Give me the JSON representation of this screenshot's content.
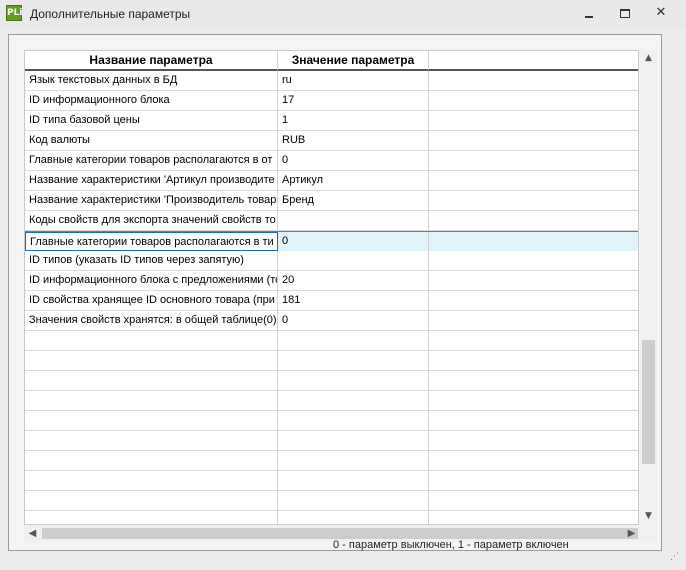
{
  "window": {
    "icon_text": "PLi",
    "title": "Дополнительные параметры",
    "close_glyph": "✕"
  },
  "grid": {
    "columns": [
      "Название параметра",
      "Значение параметра",
      ""
    ],
    "rows": [
      {
        "name": "Язык текстовых данных в БД",
        "value": "ru"
      },
      {
        "name": "ID информационного блока",
        "value": "17"
      },
      {
        "name": "ID типа базовой цены",
        "value": "1"
      },
      {
        "name": "Код валюты",
        "value": "RUB"
      },
      {
        "name": "Главные категории товаров располагаются в от",
        "value": "0"
      },
      {
        "name": "Название характеристики 'Артикул производите",
        "value": "Артикул"
      },
      {
        "name": "Название характеристики 'Производитель товар",
        "value": "Бренд"
      },
      {
        "name": "Коды свойств для экспорта значений свойств то",
        "value": ""
      },
      {
        "name": "Главные категории товаров располагаются в ти",
        "value": "0"
      },
      {
        "name": "ID типов (указать ID типов через запятую)",
        "value": ""
      },
      {
        "name": "ID информационного блока с предложениями (то",
        "value": "20"
      },
      {
        "name": "ID свойства хранящее ID основного товара (при",
        "value": "181"
      },
      {
        "name": "Значения свойств хранятся: в общей таблице(0)",
        "value": "0"
      }
    ],
    "selected_row": 8,
    "empty_rows": 10
  },
  "scrollbars": {
    "up": "▲",
    "down": "▼",
    "left": "◀",
    "right": "▶"
  },
  "status_text": "0 - параметр выключен, 1 - параметр включен",
  "grip": "⋰"
}
